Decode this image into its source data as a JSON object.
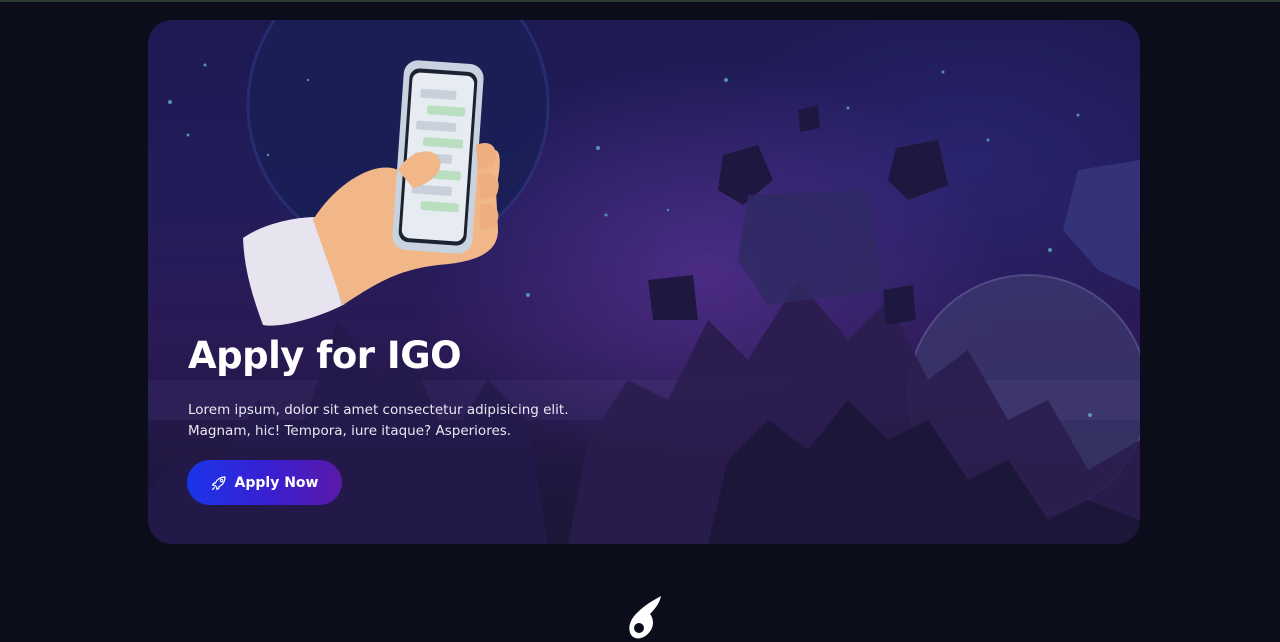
{
  "banner": {
    "title": "Apply for IGO",
    "description_line1": "Lorem ipsum, dolor sit amet consectetur adipisicing elit.",
    "description_line2": "Magnam, hic! Tempora, iure itaque? Asperiores.",
    "apply_button_label": "Apply Now",
    "apply_button_icon": "rocket-icon",
    "illustration": "hand-holding-phone",
    "background": "space-scene-with-planets-and-rocks"
  },
  "footer": {
    "logo_icon": "brand-logo-icon"
  },
  "colors": {
    "page_background": "#0b0e1a",
    "banner_top": "#1d1a52",
    "banner_bottom": "#1b1636",
    "button_gradient_start": "#1a35e8",
    "button_gradient_end": "#5b1aa8",
    "text_primary": "#ffffff"
  }
}
